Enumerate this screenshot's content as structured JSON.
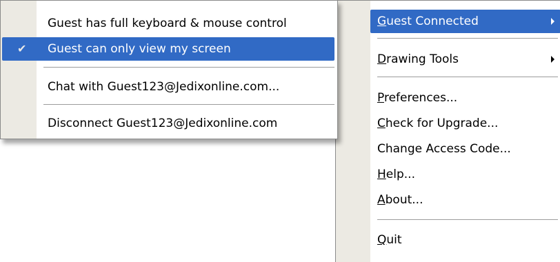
{
  "submenu": {
    "items": [
      {
        "label": "Guest has full keyboard & mouse control"
      },
      {
        "label": "Guest can only view my screen",
        "checked": true,
        "selected": true
      },
      {
        "label": "Chat with Guest123@Jedixonline.com..."
      },
      {
        "label": "Disconnect Guest123@Jedixonline.com"
      }
    ],
    "check_icon": "checkmark-icon"
  },
  "mainmenu": {
    "items": [
      {
        "mnemonic": "G",
        "rest": "uest Connected",
        "has_submenu": true,
        "selected": true
      },
      {
        "mnemonic": "D",
        "rest": "rawing Tools",
        "has_submenu": true
      },
      {
        "mnemonic": "P",
        "rest": "references..."
      },
      {
        "mnemonic": "C",
        "rest": "heck for Upgrade..."
      },
      {
        "label": "Change Access Code..."
      },
      {
        "mnemonic": "H",
        "rest": "elp..."
      },
      {
        "mnemonic": "A",
        "rest": "bout..."
      },
      {
        "mnemonic": "Q",
        "rest": "uit"
      }
    ],
    "arrow_icon": "submenu-arrow-icon"
  },
  "colors": {
    "highlight": "#316ac5",
    "gutter": "#eceae3",
    "separator": "#9c9c9c"
  }
}
